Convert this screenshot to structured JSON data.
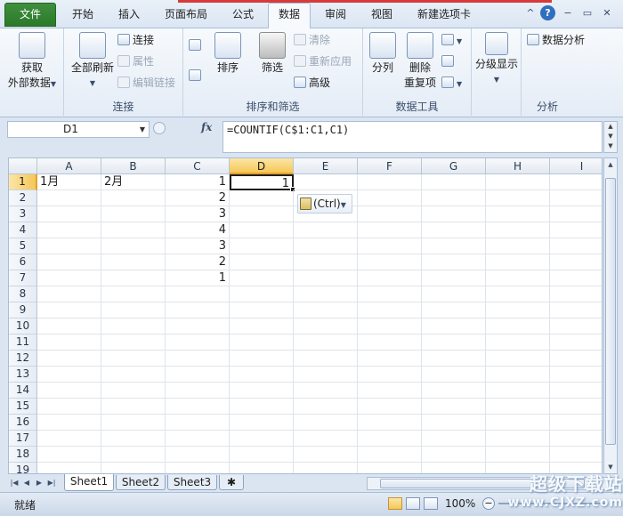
{
  "tabs": [
    {
      "label": "文件",
      "name": "tab-file"
    },
    {
      "label": "开始",
      "name": "tab-home"
    },
    {
      "label": "插入",
      "name": "tab-insert"
    },
    {
      "label": "页面布局",
      "name": "tab-page-layout"
    },
    {
      "label": "公式",
      "name": "tab-formulas"
    },
    {
      "label": "数据",
      "name": "tab-data"
    },
    {
      "label": "审阅",
      "name": "tab-review"
    },
    {
      "label": "视图",
      "name": "tab-view"
    },
    {
      "label": "新建选项卡",
      "name": "tab-new"
    }
  ],
  "active_tab": "数据",
  "window_controls": {
    "caret": "^",
    "help": "?",
    "minimize": "−",
    "restore": "▭",
    "close": "✕"
  },
  "ribbon": {
    "get_external": {
      "line1": "获取",
      "line2": "外部数据"
    },
    "connections": {
      "refresh_all": "全部刷新",
      "connections": "连接",
      "properties": "属性",
      "edit_links": "编辑链接",
      "title": "连接"
    },
    "sort_filter": {
      "sort": "排序",
      "filter": "筛选",
      "clear": "清除",
      "reapply": "重新应用",
      "advanced": "高级",
      "title": "排序和筛选"
    },
    "data_tools": {
      "text_to_columns": "分列",
      "remove_dup_line1": "删除",
      "remove_dup_line2": "重复项",
      "title": "数据工具"
    },
    "outline": {
      "show_outline": "分级显示",
      "title": "分析"
    },
    "analysis": {
      "data_analysis": "数据分析"
    }
  },
  "formula_bar": {
    "name_box": "D1",
    "fx": "fx",
    "formula": "=COUNTIF(C$1:C1,C1)"
  },
  "columns": [
    "A",
    "B",
    "C",
    "D",
    "E",
    "F",
    "G",
    "H",
    "I"
  ],
  "rows": [
    "1",
    "2",
    "3",
    "4",
    "5",
    "6",
    "7",
    "8",
    "9",
    "10",
    "11",
    "12",
    "13",
    "14",
    "15",
    "16",
    "17",
    "18",
    "19"
  ],
  "cells": {
    "A1": "1月",
    "B1": "2月",
    "C1": "1",
    "C2": "2",
    "C3": "3",
    "C4": "4",
    "C5": "3",
    "C6": "2",
    "C7": "1",
    "D1": "1"
  },
  "active_cell": "D1",
  "paste_options": {
    "label": "(Ctrl)"
  },
  "sheets": [
    "Sheet1",
    "Sheet2",
    "Sheet3"
  ],
  "active_sheet": "Sheet1",
  "status": {
    "ready": "就绪",
    "zoom": "100%"
  },
  "watermark": {
    "line1": "超级下载站",
    "line2": "www.CJXZ.com"
  }
}
